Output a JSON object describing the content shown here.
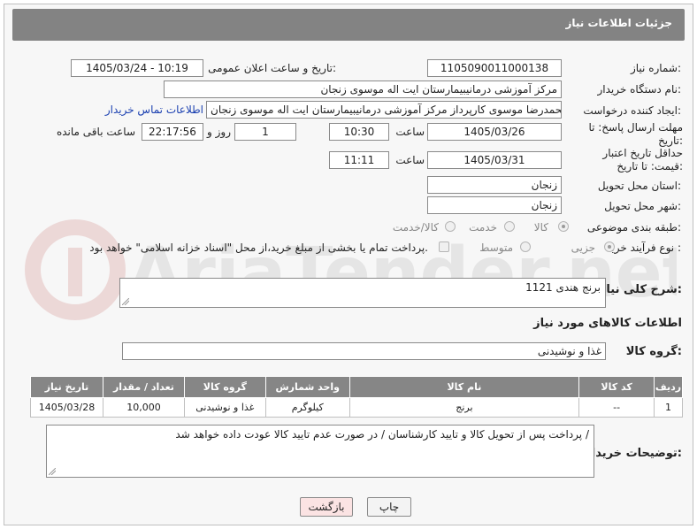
{
  "header": {
    "title": "جزئیات اطلاعات نیاز"
  },
  "fields": {
    "need_number_label": "شماره نیاز:",
    "need_number": "1105090011000138",
    "announce_label": "تاریخ و ساعت اعلان عمومی:",
    "announce_value": "1405/03/24 - 10:19",
    "buyer_org_label": "نام دستگاه خریدار:",
    "buyer_org": "مرکز آموزشی درمانیبیمارستان ایت اله موسوی زنجان",
    "creator_label": "ایجاد کننده درخواست:",
    "creator": "سیدمحمدرضا موسوی کارپرداز مرکز آموزشی درمانیبیمارستان ایت اله موسوی زنجان",
    "contact_link": "اطلاعات تماس خریدار",
    "reply_deadline_label": "مهلت ارسال پاسخ: تا تاریخ:",
    "reply_date": "1405/03/26",
    "time_label": "ساعت",
    "reply_time": "10:30",
    "days_value": "1",
    "days_label": "روز و",
    "remaining_time": "22:17:56",
    "remaining_label": "ساعت باقی مانده",
    "price_deadline_label": "حداقل تاریخ اعتبار قیمت: تا تاریخ:",
    "price_date": "1405/03/31",
    "price_time": "11:11",
    "province_label": "استان محل تحویل:",
    "province": "زنجان",
    "city_label": "شهر محل تحویل:",
    "city": "زنجان",
    "category_label": "طبقه بندی موضوعی:",
    "category_options": [
      "کالا",
      "خدمت",
      "کالا/خدمت"
    ],
    "process_label": "نوع فرآیند خرید :",
    "process_options": [
      "جزیی",
      "متوسط"
    ],
    "payment_note": "پرداخت تمام یا بخشی از مبلغ خرید،از محل \"اسناد خزانه اسلامی\" خواهد بود."
  },
  "description": {
    "label": "شرح کلی نیاز:",
    "value": "برنج هندی  1121"
  },
  "goods_info": {
    "title": "اطلاعات کالاهای مورد نیاز",
    "group_label": "گروه کالا:",
    "group_value": "غذا و نوشیدنی"
  },
  "table": {
    "headers": [
      "ردیف",
      "کد کالا",
      "نام کالا",
      "واحد شمارش",
      "گروه کالا",
      "تعداد / مقدار",
      "تاریخ نیاز"
    ],
    "rows": [
      [
        "1",
        "--",
        "برنج",
        "کیلوگرم",
        "غذا و نوشیدنی",
        "10,000",
        "1405/03/28"
      ]
    ]
  },
  "buyer_notes": {
    "label": "توضیحات خریدار:",
    "value": "پرداخت پس از تحویل کالا و تایید کارشناسان / در صورت عدم تایید کالا عودت داده خواهد شد /"
  },
  "buttons": {
    "print": "چاپ",
    "back": "بازگشت"
  },
  "watermark": "AriaTender.net"
}
